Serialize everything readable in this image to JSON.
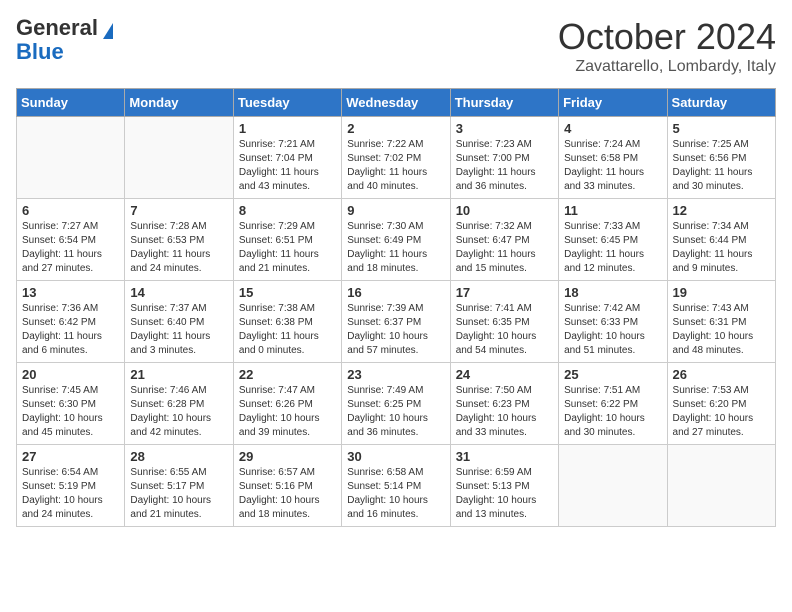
{
  "header": {
    "logo_general": "General",
    "logo_blue": "Blue",
    "month": "October 2024",
    "location": "Zavattarello, Lombardy, Italy"
  },
  "days_of_week": [
    "Sunday",
    "Monday",
    "Tuesday",
    "Wednesday",
    "Thursday",
    "Friday",
    "Saturday"
  ],
  "weeks": [
    [
      {
        "day": "",
        "info": ""
      },
      {
        "day": "",
        "info": ""
      },
      {
        "day": "1",
        "info": "Sunrise: 7:21 AM\nSunset: 7:04 PM\nDaylight: 11 hours and 43 minutes."
      },
      {
        "day": "2",
        "info": "Sunrise: 7:22 AM\nSunset: 7:02 PM\nDaylight: 11 hours and 40 minutes."
      },
      {
        "day": "3",
        "info": "Sunrise: 7:23 AM\nSunset: 7:00 PM\nDaylight: 11 hours and 36 minutes."
      },
      {
        "day": "4",
        "info": "Sunrise: 7:24 AM\nSunset: 6:58 PM\nDaylight: 11 hours and 33 minutes."
      },
      {
        "day": "5",
        "info": "Sunrise: 7:25 AM\nSunset: 6:56 PM\nDaylight: 11 hours and 30 minutes."
      }
    ],
    [
      {
        "day": "6",
        "info": "Sunrise: 7:27 AM\nSunset: 6:54 PM\nDaylight: 11 hours and 27 minutes."
      },
      {
        "day": "7",
        "info": "Sunrise: 7:28 AM\nSunset: 6:53 PM\nDaylight: 11 hours and 24 minutes."
      },
      {
        "day": "8",
        "info": "Sunrise: 7:29 AM\nSunset: 6:51 PM\nDaylight: 11 hours and 21 minutes."
      },
      {
        "day": "9",
        "info": "Sunrise: 7:30 AM\nSunset: 6:49 PM\nDaylight: 11 hours and 18 minutes."
      },
      {
        "day": "10",
        "info": "Sunrise: 7:32 AM\nSunset: 6:47 PM\nDaylight: 11 hours and 15 minutes."
      },
      {
        "day": "11",
        "info": "Sunrise: 7:33 AM\nSunset: 6:45 PM\nDaylight: 11 hours and 12 minutes."
      },
      {
        "day": "12",
        "info": "Sunrise: 7:34 AM\nSunset: 6:44 PM\nDaylight: 11 hours and 9 minutes."
      }
    ],
    [
      {
        "day": "13",
        "info": "Sunrise: 7:36 AM\nSunset: 6:42 PM\nDaylight: 11 hours and 6 minutes."
      },
      {
        "day": "14",
        "info": "Sunrise: 7:37 AM\nSunset: 6:40 PM\nDaylight: 11 hours and 3 minutes."
      },
      {
        "day": "15",
        "info": "Sunrise: 7:38 AM\nSunset: 6:38 PM\nDaylight: 11 hours and 0 minutes."
      },
      {
        "day": "16",
        "info": "Sunrise: 7:39 AM\nSunset: 6:37 PM\nDaylight: 10 hours and 57 minutes."
      },
      {
        "day": "17",
        "info": "Sunrise: 7:41 AM\nSunset: 6:35 PM\nDaylight: 10 hours and 54 minutes."
      },
      {
        "day": "18",
        "info": "Sunrise: 7:42 AM\nSunset: 6:33 PM\nDaylight: 10 hours and 51 minutes."
      },
      {
        "day": "19",
        "info": "Sunrise: 7:43 AM\nSunset: 6:31 PM\nDaylight: 10 hours and 48 minutes."
      }
    ],
    [
      {
        "day": "20",
        "info": "Sunrise: 7:45 AM\nSunset: 6:30 PM\nDaylight: 10 hours and 45 minutes."
      },
      {
        "day": "21",
        "info": "Sunrise: 7:46 AM\nSunset: 6:28 PM\nDaylight: 10 hours and 42 minutes."
      },
      {
        "day": "22",
        "info": "Sunrise: 7:47 AM\nSunset: 6:26 PM\nDaylight: 10 hours and 39 minutes."
      },
      {
        "day": "23",
        "info": "Sunrise: 7:49 AM\nSunset: 6:25 PM\nDaylight: 10 hours and 36 minutes."
      },
      {
        "day": "24",
        "info": "Sunrise: 7:50 AM\nSunset: 6:23 PM\nDaylight: 10 hours and 33 minutes."
      },
      {
        "day": "25",
        "info": "Sunrise: 7:51 AM\nSunset: 6:22 PM\nDaylight: 10 hours and 30 minutes."
      },
      {
        "day": "26",
        "info": "Sunrise: 7:53 AM\nSunset: 6:20 PM\nDaylight: 10 hours and 27 minutes."
      }
    ],
    [
      {
        "day": "27",
        "info": "Sunrise: 6:54 AM\nSunset: 5:19 PM\nDaylight: 10 hours and 24 minutes."
      },
      {
        "day": "28",
        "info": "Sunrise: 6:55 AM\nSunset: 5:17 PM\nDaylight: 10 hours and 21 minutes."
      },
      {
        "day": "29",
        "info": "Sunrise: 6:57 AM\nSunset: 5:16 PM\nDaylight: 10 hours and 18 minutes."
      },
      {
        "day": "30",
        "info": "Sunrise: 6:58 AM\nSunset: 5:14 PM\nDaylight: 10 hours and 16 minutes."
      },
      {
        "day": "31",
        "info": "Sunrise: 6:59 AM\nSunset: 5:13 PM\nDaylight: 10 hours and 13 minutes."
      },
      {
        "day": "",
        "info": ""
      },
      {
        "day": "",
        "info": ""
      }
    ]
  ]
}
